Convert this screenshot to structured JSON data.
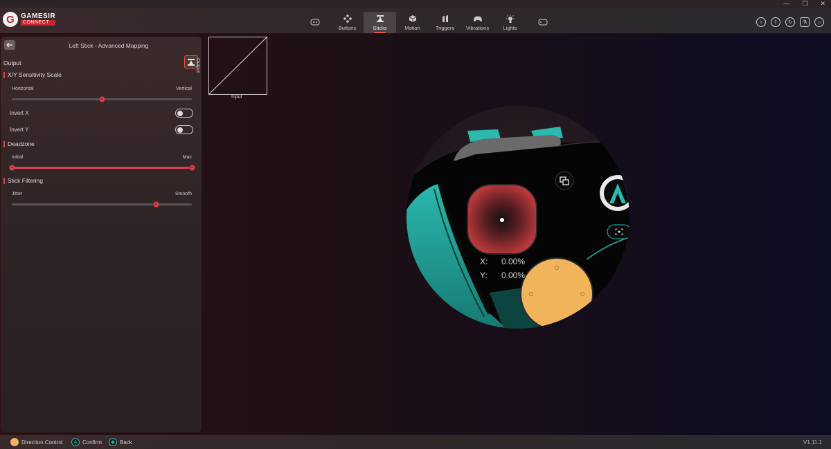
{
  "app": {
    "logo_name": "GAMESIR",
    "logo_sub": "CONNECT",
    "version": "V1.11.1"
  },
  "window": {
    "minimize_glyph": "—",
    "restore_glyph": "❐",
    "close_glyph": "✕"
  },
  "tabs": [
    {
      "label": "",
      "icon": "controller-outline-icon"
    },
    {
      "label": "Buttons",
      "icon": "dpad-buttons-icon"
    },
    {
      "label": "Sticks",
      "icon": "stick-icon",
      "active": true
    },
    {
      "label": "Motion",
      "icon": "cube-icon"
    },
    {
      "label": "Triggers",
      "icon": "trigger-icon"
    },
    {
      "label": "Vibrations",
      "icon": "vibration-icon"
    },
    {
      "label": "Lights",
      "icon": "light-icon"
    },
    {
      "label": "",
      "icon": "controller-outline-icon"
    }
  ],
  "panel": {
    "title": "Left Stick - Advanced Mapping",
    "output_label": "Output",
    "sensitivity": {
      "title": "X/Y Sensitivity Scale",
      "left_label": "Horizontal",
      "right_label": "Vertical",
      "value": 0.5
    },
    "invert_x": {
      "label": "Invert X",
      "on": false
    },
    "invert_y": {
      "label": "Invert Y",
      "on": false
    },
    "deadzone": {
      "title": "Deadzone",
      "left_label": "Initial",
      "right_label": "Max",
      "min": 0.0,
      "max": 1.0
    },
    "filtering": {
      "title": "Stick Filtering",
      "left_label": "Jitter",
      "right_label": "Smooth",
      "value": 0.8
    }
  },
  "graph": {
    "xlabel": "Input",
    "ylabel": "Output"
  },
  "readout": {
    "x_label": "X:",
    "x_value": "0.00%",
    "y_label": "Y:",
    "y_value": "0.00%"
  },
  "hints": [
    {
      "label": "Direction Control",
      "color": "#f2b45a"
    },
    {
      "label": "Confirm",
      "color": "#35b7b0"
    },
    {
      "label": "Back",
      "color": "#35b7b0"
    }
  ],
  "colors": {
    "accent": "#d8434d",
    "active_tab_underline": "#e0573a",
    "controller_teal": "#2bb8ad",
    "stick_red": "#c23a3e",
    "dpad_yellow": "#f2b45a"
  }
}
